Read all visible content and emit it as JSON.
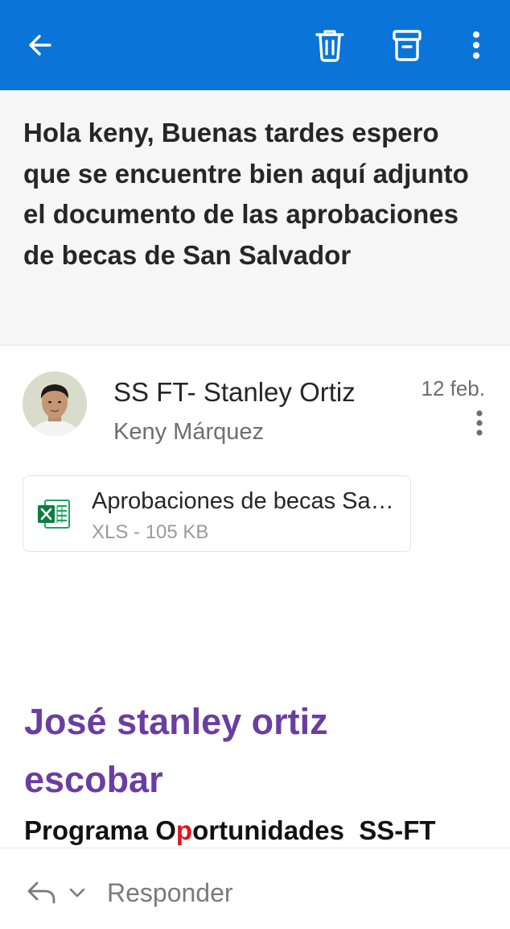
{
  "toolbar": {
    "back_icon": "arrow-left-icon",
    "delete_icon": "trash-icon",
    "archive_icon": "archive-box-icon",
    "more_icon": "more-vertical-icon",
    "background": "#0a74d8"
  },
  "email": {
    "subject": "Hola keny, Buenas tardes espero que se encuentre bien aquí adjunto el documento de las aprobaciones de becas de San Salvador",
    "sender": "SS FT- Stanley Ortiz",
    "recipient": "Keny Márquez",
    "date": "12 feb."
  },
  "attachment": {
    "name": "Aprobaciones de becas San Salvador",
    "meta": "XLS - 105 KB",
    "icon": "excel-file-icon"
  },
  "signature": {
    "name": "José stanley ortiz escobar",
    "program_part1": "Programa O",
    "program_red": "p",
    "program_part2": "ortunidades  SS-FT",
    "name_color": "#6a3ea1",
    "accent_red": "#e0121b"
  },
  "reply_bar": {
    "label": "Responder",
    "reply_icon": "reply-arrow-icon",
    "chevron_icon": "chevron-down-icon"
  }
}
